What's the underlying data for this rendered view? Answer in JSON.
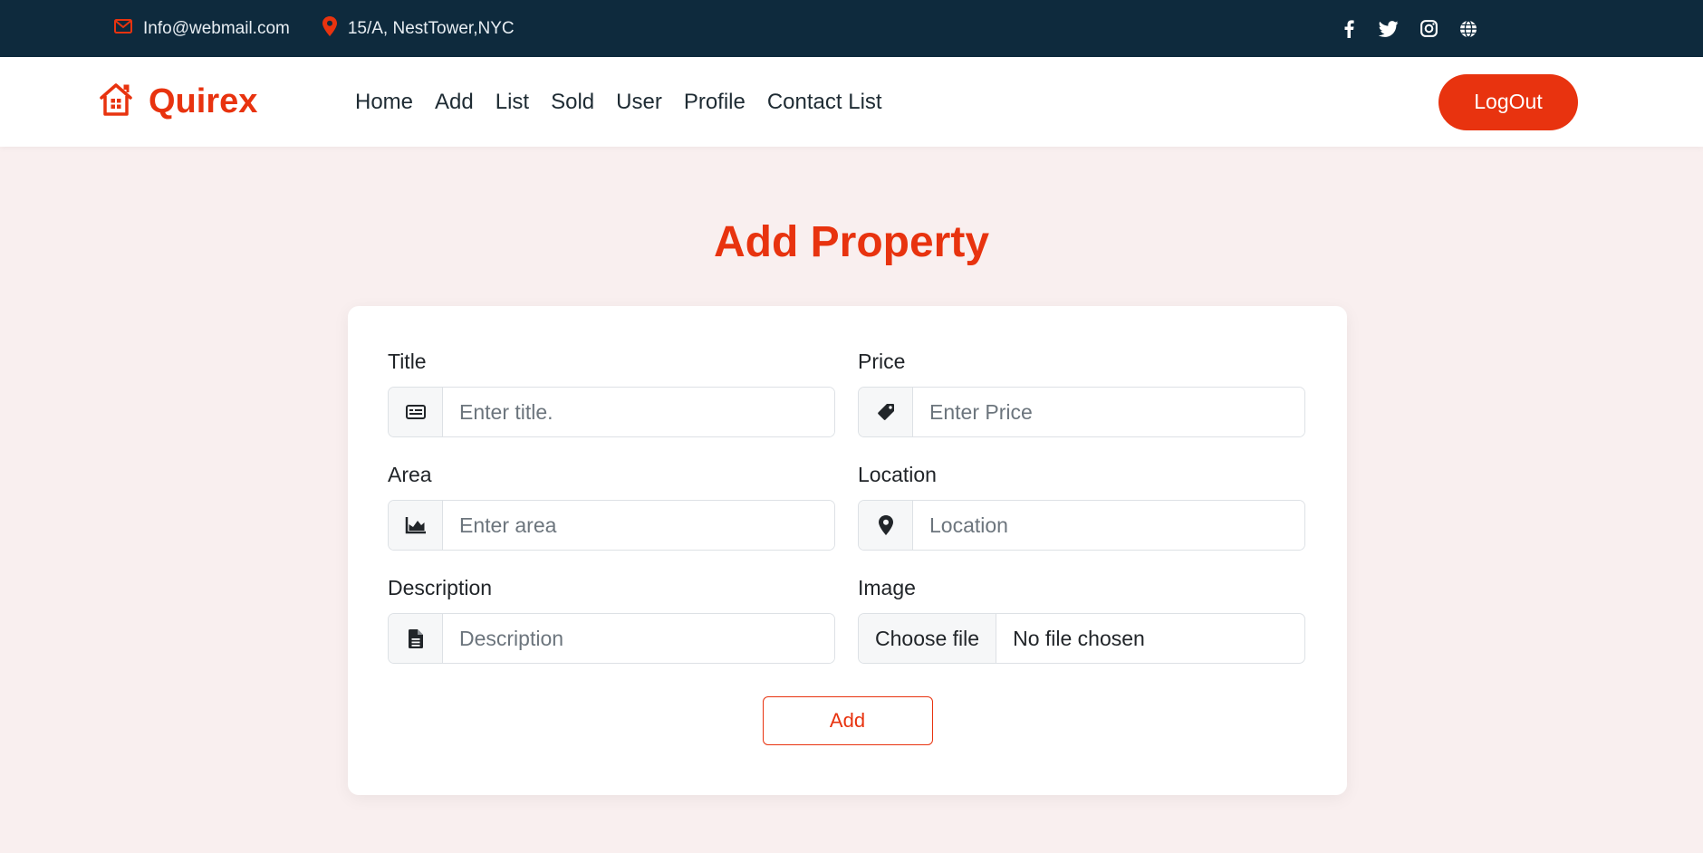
{
  "topbar": {
    "email": "Info@webmail.com",
    "address": "15/A, NestTower,NYC",
    "social_icons": [
      "facebook-icon",
      "twitter-icon",
      "instagram-icon",
      "globe-icon"
    ]
  },
  "navbar": {
    "brand": "Quirex",
    "links": [
      "Home",
      "Add",
      "List",
      "Sold",
      "User",
      "Profile",
      "Contact List"
    ],
    "logout_label": "LogOut"
  },
  "page": {
    "title": "Add Property"
  },
  "form": {
    "title": {
      "label": "Title",
      "placeholder": "Enter title.",
      "icon": "id-card-icon"
    },
    "price": {
      "label": "Price",
      "placeholder": "Enter Price",
      "icon": "price-tag-icon"
    },
    "area": {
      "label": "Area",
      "placeholder": "Enter area",
      "icon": "area-chart-icon"
    },
    "location": {
      "label": "Location",
      "placeholder": "Location",
      "icon": "map-pin-icon"
    },
    "description": {
      "label": "Description",
      "placeholder": "Description",
      "icon": "document-icon"
    },
    "image": {
      "label": "Image",
      "choose_label": "Choose file",
      "status": "No file chosen"
    },
    "submit_label": "Add"
  },
  "colors": {
    "accent": "#e8330f",
    "topbar_bg": "#0e2a3d",
    "page_bg": "#f9efef"
  }
}
